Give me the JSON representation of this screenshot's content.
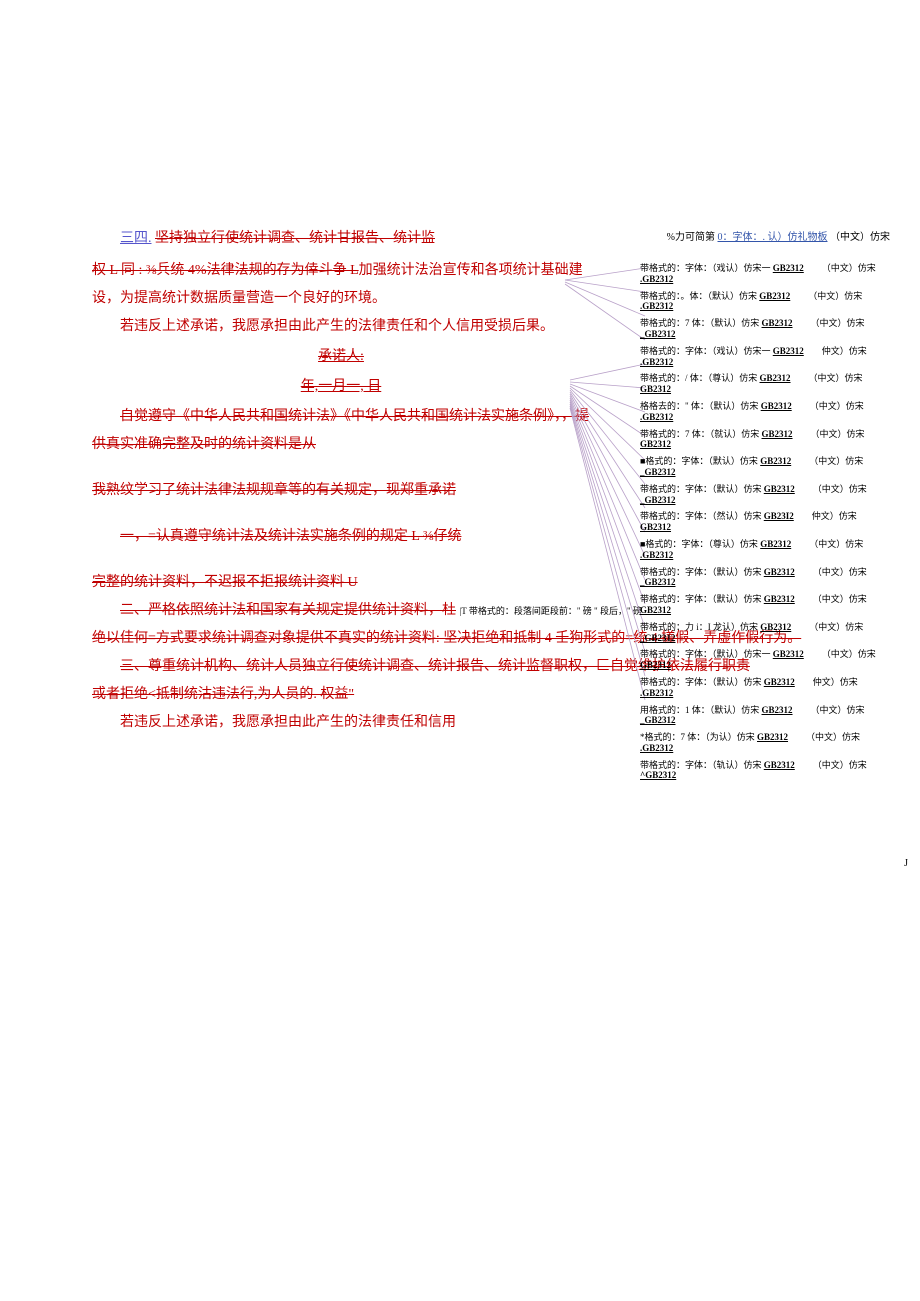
{
  "topHeading": {
    "prefix": "三四.",
    "main": "坚持独立行使统计调查、统计甘报告、统计监",
    "notePrefix": "%力可简第",
    "noteUnderline": "0：字体：. 认）仿礼物板",
    "noteTail": "（中文）仿宋"
  },
  "body": {
    "p1_strike": "权 L 同 : ⅜兵统 4%法律法规的存为倖斗争 L",
    "p1_rest": "加强统计法治宣传和各项统计基础建设，为提高统计数据质量营造一个良好的环境。",
    "p2": "若违反上述承诺，我愿承担由此产生的法律责任和个人信用受损后果。",
    "signLabel": "承诺人:",
    "signDate": "年,一月一,   日",
    "p3": "自觉遵守《中华人民共和国统计法》《中华人民共和国统计法实施条例》，，提供真实准确完整及时的统计资料是从",
    "p4": "我熟纹学习了统计法律法规规章等的有关规定，现郑重承诺",
    "p5": "一，=认真遵守统计法及统计法实施条例的规定 L ⅜仔统",
    "p6": "完整的统计资料，不迟报不拒报统计资料 U",
    "p7a": "二、严格依照统计法和国家有关规定提供统计资料，杜",
    "p7note": "|T 带格式的：段落间距段前：\" 磅 \" 段后，\" 磅",
    "p7J": "J",
    "p7b": "绝以佳何=方式要求统计调查对象提供不真实的统计资料: 坚决",
    "p7c_strike": "拒绝和抵制 4 壬狗形式的=统 4 搓假、弄虚作假行为。",
    "p8a": "三、尊重统计机构、统计人员独立行使统计调查、统计报告、统计监督职权，匚自觉维护依法履行职责",
    "p8b": "或者拒绝<抵制统沽违法行,为人员的. 权益\"",
    "p9": "若违反上述承诺，我愿承担由此产生的法律责任和信用"
  },
  "revisions": [
    {
      "prefix": "带格式的：字体：（戏认）仿宋一 ",
      "gb": "GB2312",
      "tail": "（中文）仿宋",
      "gb2": ".GB2312"
    },
    {
      "prefix": "带格式的：。体：（默认）仿宋 ",
      "gb": "GB2312",
      "tail": "（中文）仿宋",
      "gb2": ".GB2312"
    },
    {
      "prefix": "带格式的：7 体：（默认）仿宋 ",
      "gb": "GB2312",
      "tail": "（中文）仿宋",
      "gb2": "_GB2312"
    },
    {
      "prefix": "带格式的：字体：（戏认）仿宋一 ",
      "gb": "GB2312",
      "tail": "仲文）仿宋",
      "gb2": ".GB2312"
    },
    {
      "prefix": "带格式的：/ 体：（尊认）仿宋 ",
      "gb": "GB2312",
      "tail": "（中文）仿宋",
      "gb2": "GB2312"
    },
    {
      "prefix": "格格去的：\" 体：（默认）仿宋 ",
      "gb": "GB2312",
      "tail": "（中文）仿宋",
      "gb2": ".GB2312"
    },
    {
      "prefix": "带格式的：7 体：（就认）仿宋 ",
      "gb": "GB2312",
      "tail": "（中文）仿宋",
      "gb2": "GB2312"
    },
    {
      "prefix": "■格式的：字体：（默认）仿宋 ",
      "gb": "GB2312",
      "tail": "（中文）仿宋",
      "gb2": "_GB2312"
    },
    {
      "prefix": "带格式的：字体：（默认）仿宋 ",
      "gb": "GB2312",
      "tail": "（中文）仿宋",
      "gb2": "_GB2312"
    },
    {
      "prefix": "带格式的：字体：（然认）仿宋 ",
      "gb": "GB23I2",
      "tail": "仲文）仿宋",
      "gb2": "GB2312"
    },
    {
      "prefix": "■格式的：字体：（尊认）仿宋 ",
      "gb": "GB2312",
      "tail": "（中文）仿宋",
      "gb2": ".GB2312"
    },
    {
      "prefix": "带格式的：字体：（默认）仿宋 ",
      "gb": "GB2312",
      "tail": "（中文）仿宋",
      "gb2": "_GB2312"
    },
    {
      "prefix": "带格式的：字体：（默认）仿宋 ",
      "gb": "GB2312",
      "tail": "（中文）仿宋",
      "gb2": "GB2312"
    },
    {
      "prefix": "带格式的：力 i：I 龙认）仿宋 ",
      "gb": "GB2312",
      "tail": "（中文）仿宋",
      "gb2": "_GB2312"
    },
    {
      "prefix": "带格式的：字体：（默认）仿宋一 ",
      "gb": "GB2312",
      "tail": "（中文）仿宋",
      "gb2": "GB2312"
    },
    {
      "prefix": "带格式的：字体：（默认）仿宋 ",
      "gb": "GB2312",
      "tail": "仲文）仿宋",
      "gb2": ".GB2312"
    },
    {
      "prefix": "用格式的：1 体：（默认）仿宋 ",
      "gb": "GB2312",
      "tail": "（中文）仿宋",
      "gb2": "_GB2312"
    },
    {
      "prefix": "*格式的：7 体：（为认）仿宋 ",
      "gb": "GB2312",
      "tail": "（中文）仿宋",
      "gb2": ".GB2312"
    },
    {
      "prefix": "带格式的：字体：（轨认）仿宋 ",
      "gb": "GB2312",
      "tail": "（中文）仿宋",
      "gb2": "^GB2312"
    }
  ]
}
